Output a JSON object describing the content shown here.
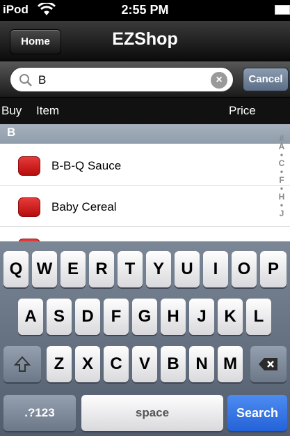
{
  "status_bar": {
    "carrier": "iPod",
    "time": "2:55 PM"
  },
  "nav": {
    "home_label": "Home",
    "title": "EZShop"
  },
  "search": {
    "value": "B",
    "cancel_label": "Cancel"
  },
  "columns": {
    "buy": "Buy",
    "item": "Item",
    "price": "Price"
  },
  "list": {
    "section": "B",
    "items": [
      {
        "name": "B-B-Q Sauce"
      },
      {
        "name": "Baby Cereal"
      }
    ]
  },
  "index": {
    "letters": [
      "#",
      "A",
      "C",
      "F",
      "H",
      "J"
    ]
  },
  "keyboard": {
    "row1": [
      "Q",
      "W",
      "E",
      "R",
      "T",
      "Y",
      "U",
      "I",
      "O",
      "P"
    ],
    "row2": [
      "A",
      "S",
      "D",
      "F",
      "G",
      "H",
      "J",
      "K",
      "L"
    ],
    "row3": [
      "Z",
      "X",
      "C",
      "V",
      "B",
      "N",
      "M"
    ],
    "numbers_label": ".?123",
    "space_label": "space",
    "search_label": "Search"
  },
  "colors": {
    "check": "#d41f1f",
    "search_key": "#2f6fe0",
    "section": "#98a4b2"
  },
  "icons": [
    "wifi-icon",
    "battery-icon",
    "search-icon",
    "clear-icon",
    "shift-icon",
    "backspace-icon"
  ]
}
